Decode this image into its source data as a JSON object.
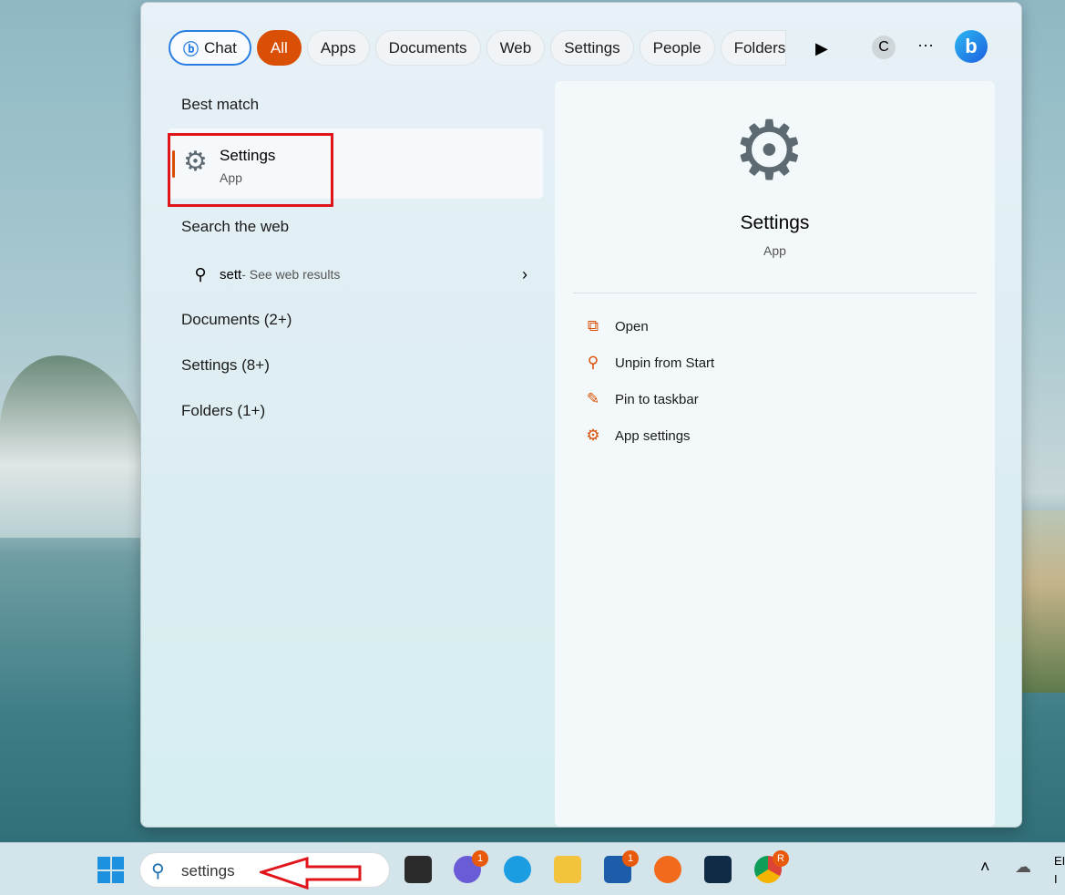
{
  "filters": {
    "chat": "Chat",
    "all": "All",
    "items": [
      "Apps",
      "Documents",
      "Web",
      "Settings",
      "People",
      "Folders"
    ],
    "avatar": "C",
    "more": "···"
  },
  "left": {
    "best_match": "Best match",
    "app_name": "Settings",
    "app_type": "App",
    "search_web": "Search the web",
    "query": "sett",
    "web_suffix": " - See web results",
    "groups": [
      "Documents (2+)",
      "Settings (8+)",
      "Folders (1+)"
    ]
  },
  "preview": {
    "title": "Settings",
    "type": "App",
    "actions": [
      {
        "label": "Open",
        "icon": "open-external-icon"
      },
      {
        "label": "Unpin from Start",
        "icon": "unpin-icon"
      },
      {
        "label": "Pin to taskbar",
        "icon": "pin-icon"
      },
      {
        "label": "App settings",
        "icon": "gear-icon"
      }
    ]
  },
  "taskbar": {
    "search_value": "settings",
    "chat_badge": "1",
    "store_badge": "1",
    "chrome_badge": "R",
    "tray_lang": "EI",
    "tray_lang2": "I"
  },
  "colors": {
    "accent": "#d94f05",
    "annotation": "#e0141b"
  }
}
